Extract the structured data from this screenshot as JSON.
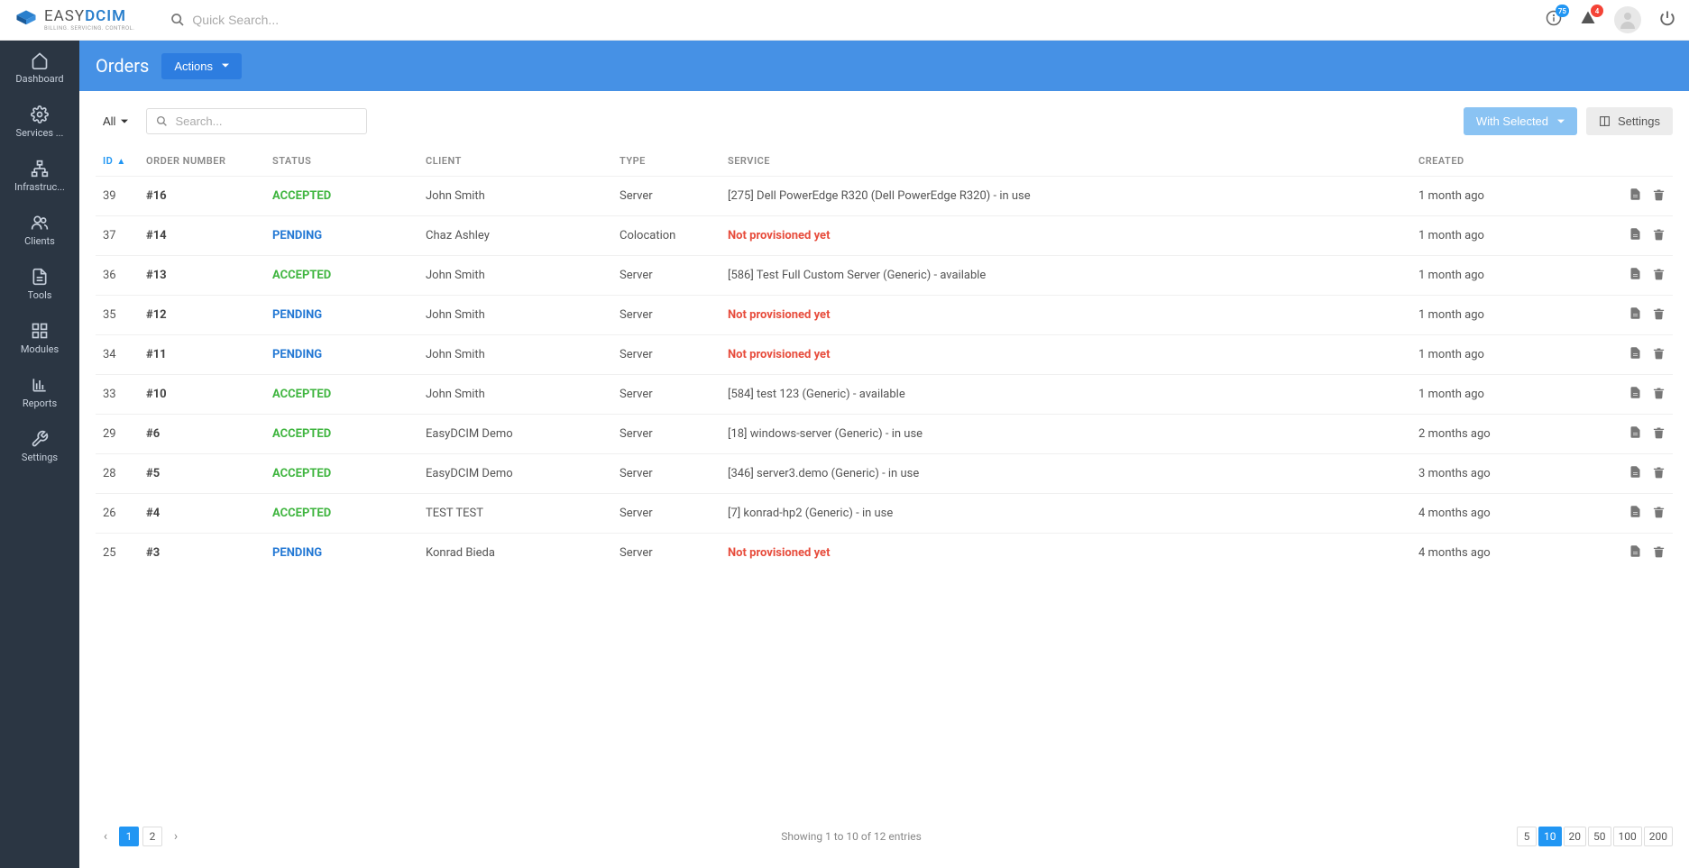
{
  "header": {
    "logo_main_left": "EASY",
    "logo_main_right": "DCIM",
    "logo_sub": "BILLING. SERVICING. CONTROL.",
    "search_placeholder": "Quick Search...",
    "info_badge": "75",
    "alert_badge": "4"
  },
  "sidebar": {
    "items": [
      {
        "label": "Dashboard",
        "icon": "home"
      },
      {
        "label": "Services ...",
        "icon": "gear"
      },
      {
        "label": "Infrastruc...",
        "icon": "sitemap"
      },
      {
        "label": "Clients",
        "icon": "users"
      },
      {
        "label": "Tools",
        "icon": "file"
      },
      {
        "label": "Modules",
        "icon": "grid"
      },
      {
        "label": "Reports",
        "icon": "chart"
      },
      {
        "label": "Settings",
        "icon": "wrench"
      }
    ]
  },
  "page": {
    "title": "Orders",
    "actions_label": "Actions"
  },
  "toolbar": {
    "filter_label": "All",
    "search_placeholder": "Search...",
    "with_selected_label": "With Selected",
    "settings_label": "Settings"
  },
  "table": {
    "headers": {
      "id": "ID",
      "order_number": "ORDER NUMBER",
      "status": "STATUS",
      "client": "CLIENT",
      "type": "TYPE",
      "service": "SERVICE",
      "created": "CREATED"
    },
    "rows": [
      {
        "id": "39",
        "order": "#16",
        "status": "ACCEPTED",
        "status_class": "accepted",
        "client": "John Smith",
        "type": "Server",
        "service": "[275] Dell PowerEdge R320 (Dell PowerEdge R320) - in use",
        "created": "1 month ago"
      },
      {
        "id": "37",
        "order": "#14",
        "status": "PENDING",
        "status_class": "pending",
        "client": "Chaz Ashley",
        "type": "Colocation",
        "service": "Not provisioned yet",
        "service_np": true,
        "created": "1 month ago"
      },
      {
        "id": "36",
        "order": "#13",
        "status": "ACCEPTED",
        "status_class": "accepted",
        "client": "John Smith",
        "type": "Server",
        "service": "[586] Test Full Custom Server (Generic) - available",
        "created": "1 month ago"
      },
      {
        "id": "35",
        "order": "#12",
        "status": "PENDING",
        "status_class": "pending",
        "client": "John Smith",
        "type": "Server",
        "service": "Not provisioned yet",
        "service_np": true,
        "created": "1 month ago"
      },
      {
        "id": "34",
        "order": "#11",
        "status": "PENDING",
        "status_class": "pending",
        "client": "John Smith",
        "type": "Server",
        "service": "Not provisioned yet",
        "service_np": true,
        "created": "1 month ago"
      },
      {
        "id": "33",
        "order": "#10",
        "status": "ACCEPTED",
        "status_class": "accepted",
        "client": "John Smith",
        "type": "Server",
        "service": "[584] test 123 (Generic) - available",
        "created": "1 month ago"
      },
      {
        "id": "29",
        "order": "#6",
        "status": "ACCEPTED",
        "status_class": "accepted",
        "client": "EasyDCIM Demo",
        "type": "Server",
        "service": "[18] windows-server (Generic) - in use",
        "created": "2 months ago"
      },
      {
        "id": "28",
        "order": "#5",
        "status": "ACCEPTED",
        "status_class": "accepted",
        "client": "EasyDCIM Demo",
        "type": "Server",
        "service": "[346] server3.demo (Generic) - in use",
        "created": "3 months ago"
      },
      {
        "id": "26",
        "order": "#4",
        "status": "ACCEPTED",
        "status_class": "accepted",
        "client": "TEST TEST",
        "type": "Server",
        "service": "[7] konrad-hp2 (Generic) - in use",
        "created": "4 months ago"
      },
      {
        "id": "25",
        "order": "#3",
        "status": "PENDING",
        "status_class": "pending",
        "client": "Konrad Bieda",
        "type": "Server",
        "service": "Not provisioned yet",
        "service_np": true,
        "created": "4 months ago"
      }
    ]
  },
  "footer": {
    "pages": [
      "1",
      "2"
    ],
    "active_page": "1",
    "showing": "Showing 1 to 10 of 12 entries",
    "sizes": [
      "5",
      "10",
      "20",
      "50",
      "100",
      "200"
    ],
    "active_size": "10"
  }
}
